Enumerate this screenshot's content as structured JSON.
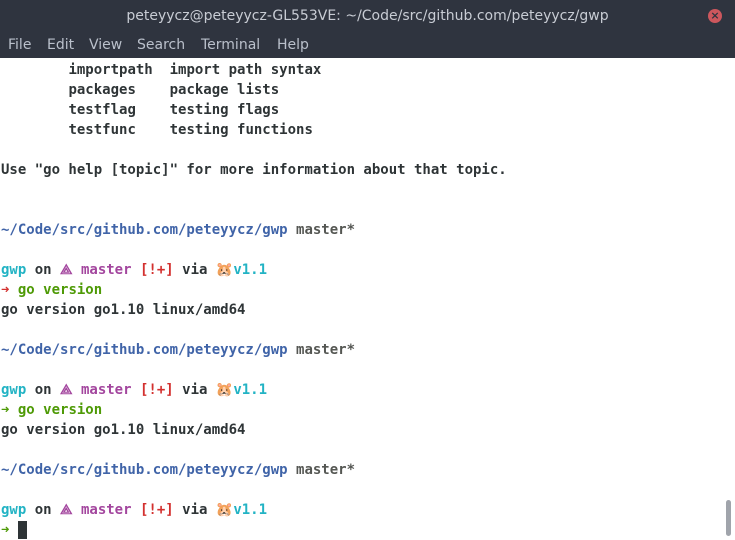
{
  "window": {
    "title": "peteyycz@peteyycz-GL553VE: ~/Code/src/github.com/peteyycz/gwp",
    "close_glyph": "×"
  },
  "menu": [
    "File",
    "Edit",
    "View",
    "Search",
    "Terminal",
    "Help"
  ],
  "help_topics": [
    {
      "name": "importpath",
      "desc": "import path syntax"
    },
    {
      "name": "packages",
      "desc": "package lists"
    },
    {
      "name": "testflag",
      "desc": "testing flags"
    },
    {
      "name": "testfunc",
      "desc": "testing functions"
    }
  ],
  "help_hint": "Use \"go help [topic]\" for more information about that topic.",
  "prompt": {
    "path": "~/Code/src/github.com/peteyycz/gwp",
    "branch_label": "master*",
    "dir": "gwp",
    "on": "on",
    "branch_icon": "⟁",
    "branch": "master",
    "status": "[!+]",
    "via": "via",
    "go_icon": "🐹",
    "version": "v1.1",
    "arrow": "➜"
  },
  "commands": [
    {
      "cmd": "go version",
      "output": "go version go1.10 linux/amd64"
    },
    {
      "cmd": "go version",
      "output": "go version go1.10 linux/amd64"
    }
  ],
  "colors": {
    "path": "#4064a8",
    "cyan": "#22b3c4",
    "magenta": "#a3469e",
    "red": "#d3312f",
    "green": "#4e9a06",
    "titlebar": "#2f343f"
  }
}
